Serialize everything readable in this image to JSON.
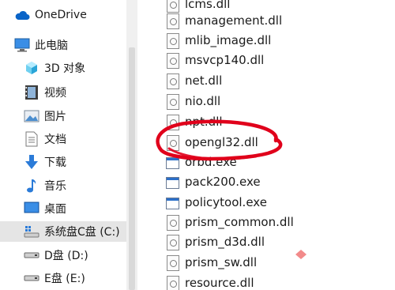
{
  "nav": {
    "items": [
      {
        "label": "OneDrive",
        "icon": "cloud-icon"
      },
      {
        "label": "此电脑",
        "icon": "computer-icon"
      },
      {
        "label": "3D 对象",
        "icon": "cube-3d-icon"
      },
      {
        "label": "视频",
        "icon": "video-icon"
      },
      {
        "label": "图片",
        "icon": "picture-icon"
      },
      {
        "label": "文档",
        "icon": "document-icon"
      },
      {
        "label": "下载",
        "icon": "download-arrow-icon"
      },
      {
        "label": "音乐",
        "icon": "music-note-icon"
      },
      {
        "label": "桌面",
        "icon": "desktop-icon"
      },
      {
        "label": "系统盘C盘 (C:)",
        "icon": "windows-drive-icon"
      },
      {
        "label": "D盘 (D:)",
        "icon": "drive-icon"
      },
      {
        "label": "E盘 (E:)",
        "icon": "drive-icon"
      }
    ],
    "selected_index": 9
  },
  "files": [
    {
      "name": "lcms.dll",
      "type": "dll"
    },
    {
      "name": "management.dll",
      "type": "dll"
    },
    {
      "name": "mlib_image.dll",
      "type": "dll"
    },
    {
      "name": "msvcp140.dll",
      "type": "dll"
    },
    {
      "name": "net.dll",
      "type": "dll"
    },
    {
      "name": "nio.dll",
      "type": "dll"
    },
    {
      "name": "npt.dll",
      "type": "dll"
    },
    {
      "name": "opengl32.dll",
      "type": "dll"
    },
    {
      "name": "orbd.exe",
      "type": "exe"
    },
    {
      "name": "pack200.exe",
      "type": "exe"
    },
    {
      "name": "policytool.exe",
      "type": "exe"
    },
    {
      "name": "prism_common.dll",
      "type": "dll"
    },
    {
      "name": "prism_d3d.dll",
      "type": "dll"
    },
    {
      "name": "prism_sw.dll",
      "type": "dll"
    },
    {
      "name": "resource.dll",
      "type": "dll"
    }
  ],
  "colors": {
    "accent": "#0078d4",
    "annotation_red": "#e0001b",
    "selected_bg": "#e5e5e5"
  }
}
